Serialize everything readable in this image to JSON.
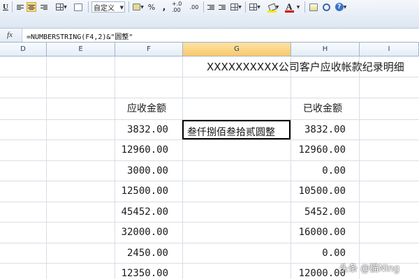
{
  "toolbar": {
    "underline_label": "U",
    "number_format_value": "自定义",
    "percent_label": "%",
    "comma_label": ",",
    "increase_decimal_label": "+.0 .00",
    "font_color_label": "A",
    "colors": {
      "fill_color": "#f5e600",
      "font_color": "#d00000",
      "active_align_bg": "#f6d88a"
    }
  },
  "formula_bar": {
    "fx_label": "fx",
    "formula": "=NUMBERSTRING(F4,2)&\"圆整\""
  },
  "columns": [
    "D",
    "E",
    "F",
    "G",
    "H",
    "I"
  ],
  "selected_column": "G",
  "sheet": {
    "title": "XXXXXXXXXX公司客户应收帐款纪录明细",
    "receivable_header": "应收金额",
    "received_header": "已收金额",
    "active_cell_value": "叁仟捌佰叁拾贰圆整",
    "rows": [
      {
        "receivable": "3832.00",
        "received": "3832.00"
      },
      {
        "receivable": "12960.00",
        "received": "12960.00"
      },
      {
        "receivable": "3000.00",
        "received": "0.00"
      },
      {
        "receivable": "12500.00",
        "received": "10500.00"
      },
      {
        "receivable": "45452.00",
        "received": "5452.00"
      },
      {
        "receivable": "32000.00",
        "received": "16000.00"
      },
      {
        "receivable": "2450.00",
        "received": "0.00"
      },
      {
        "receivable": "12350.00",
        "received": "12000.00"
      }
    ]
  },
  "watermark": "头条 @猫Ning"
}
